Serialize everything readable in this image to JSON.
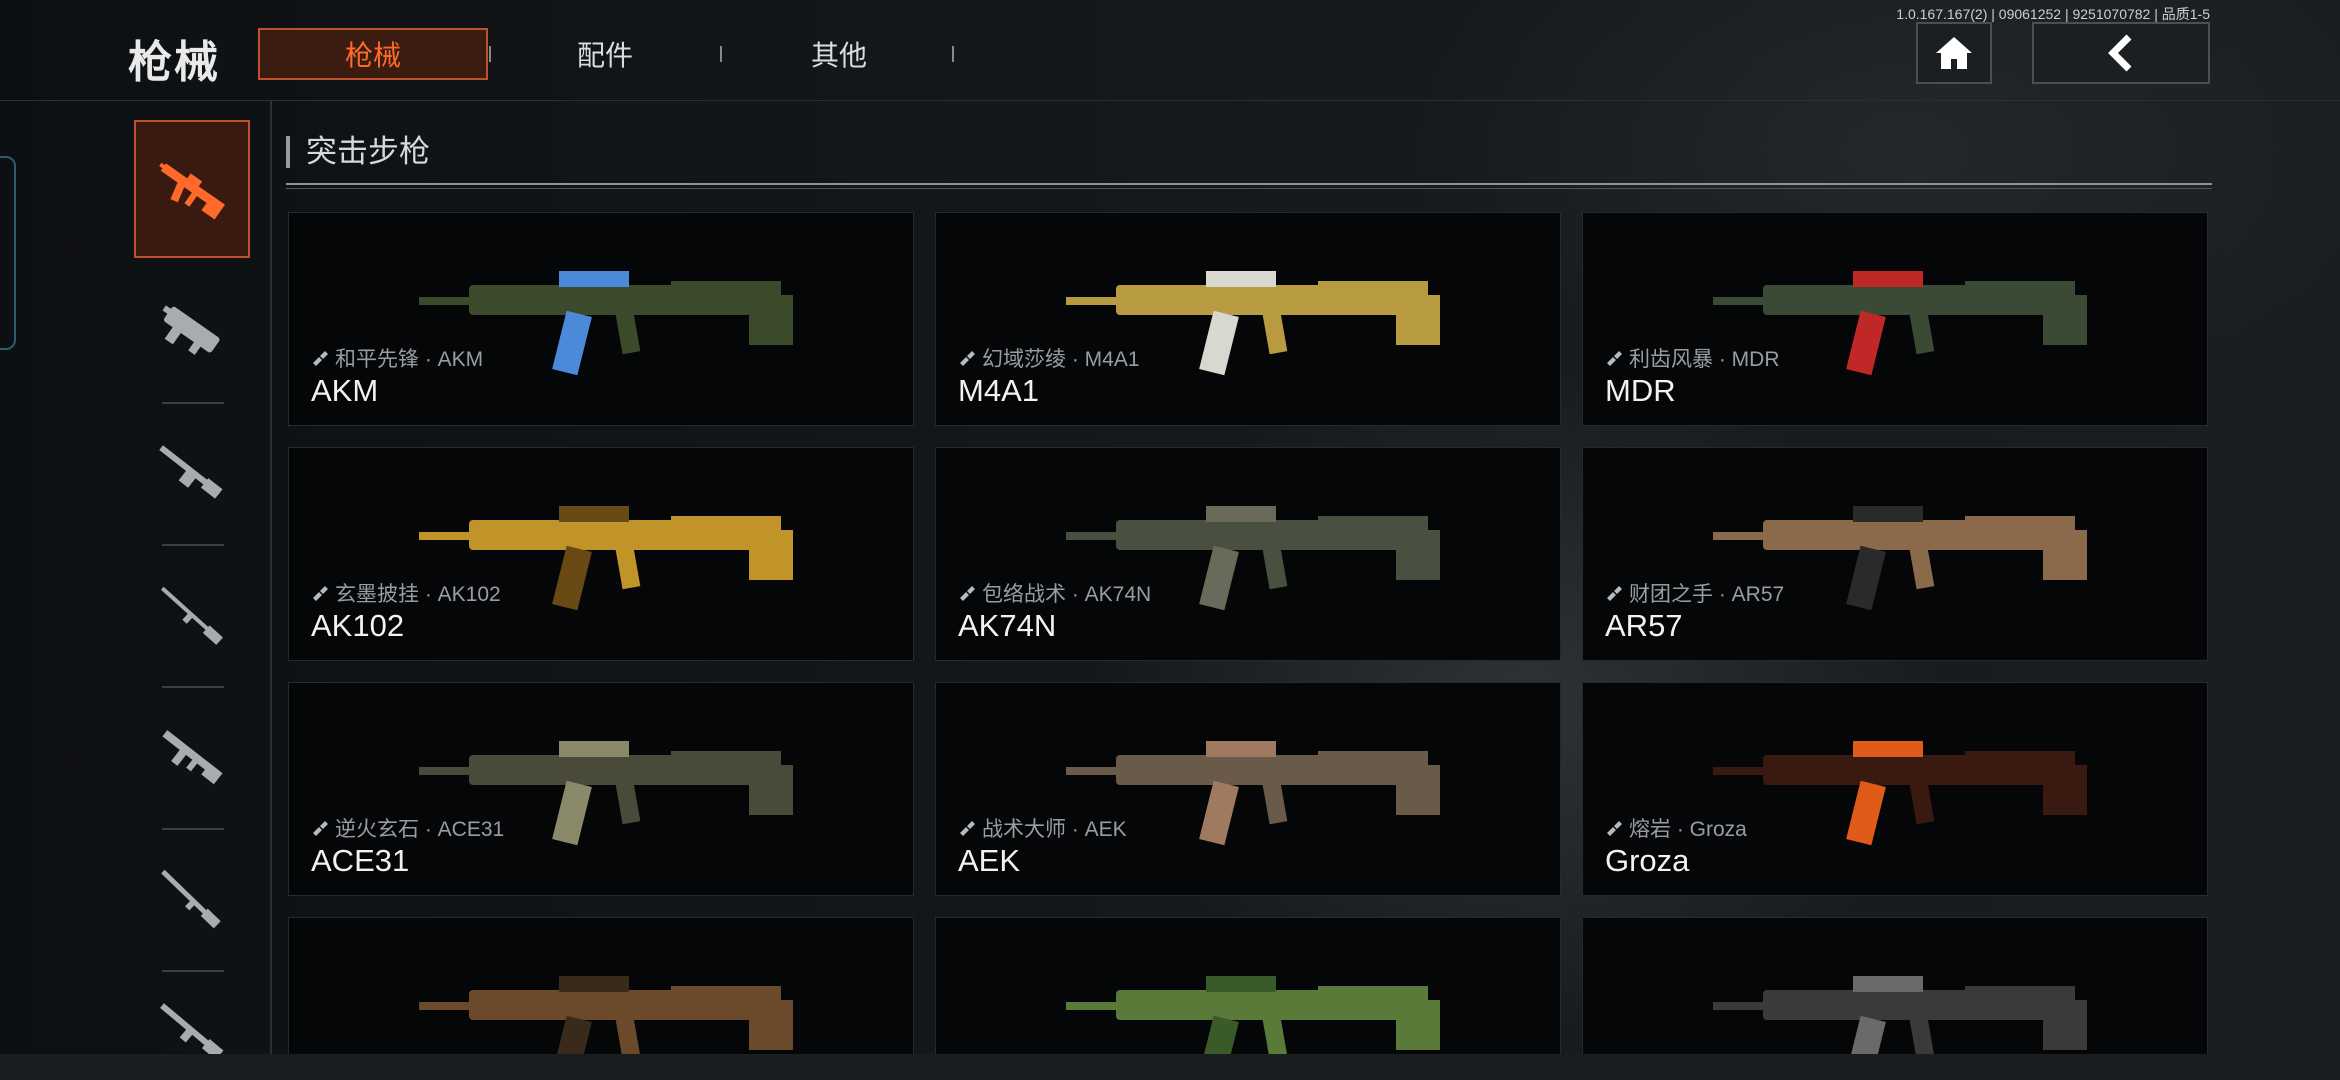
{
  "header": {
    "title": "枪械",
    "version": "1.0.167.167(2) | 09061252 | 9251070782 | 品质1-5",
    "tabs": [
      {
        "label": "枪械",
        "active": true
      },
      {
        "label": "配件",
        "active": false
      },
      {
        "label": "其他",
        "active": false
      }
    ],
    "home_icon": "home-icon",
    "back_icon": "back-chevron-icon"
  },
  "sidebar": {
    "items": [
      {
        "icon": "assault-rifle-icon",
        "active": true
      },
      {
        "icon": "smg-icon",
        "active": false
      },
      {
        "icon": "lmg-icon",
        "active": false
      },
      {
        "icon": "sniper-rifle-icon",
        "active": false
      },
      {
        "icon": "carbine-icon",
        "active": false
      },
      {
        "icon": "shotgun-icon",
        "active": false
      },
      {
        "icon": "marksman-rifle-icon",
        "active": false
      }
    ]
  },
  "section": {
    "title": "突击步枪"
  },
  "cards": [
    {
      "skin": "和平先锋 · AKM",
      "name": "AKM",
      "color": "#3a4a2a",
      "accent": "#4a8ad8"
    },
    {
      "skin": "幻域莎绫 · M4A1",
      "name": "M4A1",
      "color": "#b89a40",
      "accent": "#d8d8d0"
    },
    {
      "skin": "利齿风暴 · MDR",
      "name": "MDR",
      "color": "#3a4a34",
      "accent": "#c02828"
    },
    {
      "skin": "玄墨披挂 · AK102",
      "name": "AK102",
      "color": "#c09428",
      "accent": "#6a4a14"
    },
    {
      "skin": "包络战术 · AK74N",
      "name": "AK74N",
      "color": "#4a5040",
      "accent": "#6a6a5a"
    },
    {
      "skin": "财团之手 · AR57",
      "name": "AR57",
      "color": "#8a6a4a",
      "accent": "#2a2a2a"
    },
    {
      "skin": "逆火玄石 · ACE31",
      "name": "ACE31",
      "color": "#4a4a3a",
      "accent": "#8a8a6a"
    },
    {
      "skin": "战术大师 · AEK",
      "name": "AEK",
      "color": "#6a5a4a",
      "accent": "#a07a60"
    },
    {
      "skin": "熔岩 · Groza",
      "name": "Groza",
      "color": "#3a1a10",
      "accent": "#e05a1a"
    },
    {
      "skin": "",
      "name": "",
      "color": "#6a4a2a",
      "accent": "#3a2a1a"
    },
    {
      "skin": "",
      "name": "",
      "color": "#5a7a3a",
      "accent": "#3a5a2a"
    },
    {
      "skin": "",
      "name": "",
      "color": "#3a3a3a",
      "accent": "#6a6a6a"
    }
  ]
}
